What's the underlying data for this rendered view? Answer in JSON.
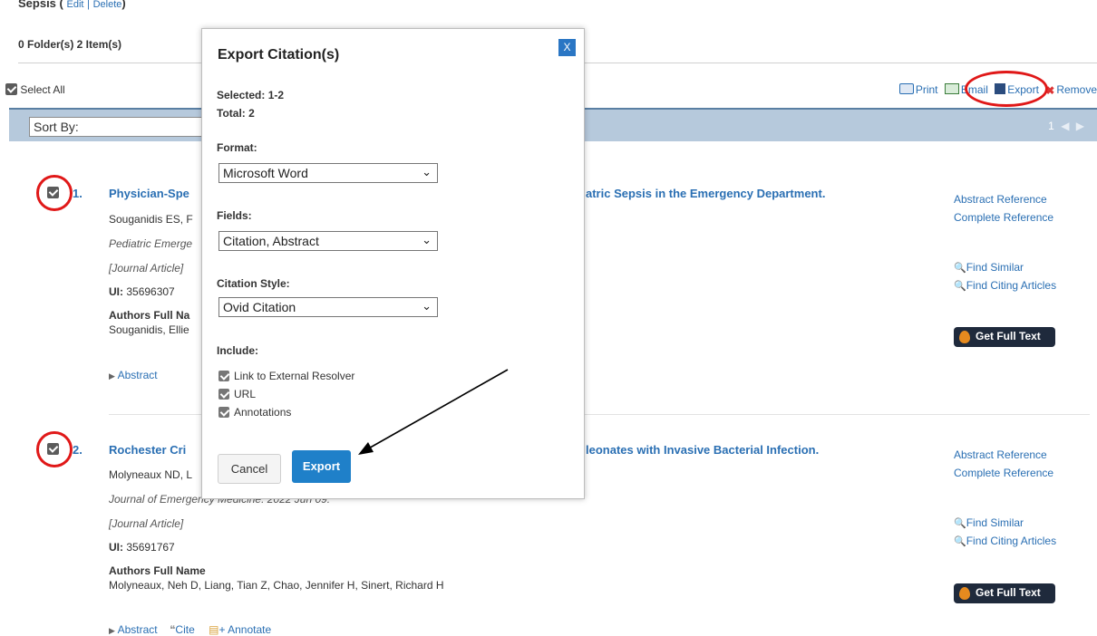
{
  "folder": {
    "name": "Sepsis",
    "paren_open": "(",
    "edit": "Edit",
    "sep": "|",
    "delete": "Delete",
    "paren_close": ")",
    "count": "0 Folder(s) 2 Item(s)"
  },
  "toolbar": {
    "select_all": "Select All",
    "print": "Print",
    "email": "Email",
    "export": "Export",
    "remove": "Remove"
  },
  "sortbar": {
    "sort_label": "Sort By:",
    "page": "1"
  },
  "results": [
    {
      "num": "1.",
      "title_start": "Physician-Spe",
      "title_end": "atric Sepsis in the Emergency Department.",
      "authors": "Souganidis ES, F",
      "journal": "Pediatric Emerge",
      "pubtype": "[Journal Article]",
      "ui_label": "UI:",
      "ui": "35696307",
      "authors_full_label": "Authors Full Na",
      "authors_full": "Souganidis, Ellie",
      "abstract": "Abstract",
      "cite": "",
      "annotate": ""
    },
    {
      "num": "2.",
      "title_start": "Rochester Cri",
      "title_end": "leonates with Invasive Bacterial Infection.",
      "authors": "Molyneaux ND, L",
      "journal": "Journal of Emergency Medicine. 2022 Jun 09.",
      "pubtype": "[Journal Article]",
      "ui_label": "UI:",
      "ui": "35691767",
      "authors_full_label": "Authors Full Name",
      "authors_full": "Molyneaux, Neh D, Liang, Tian Z, Chao, Jennifer H, Sinert, Richard H",
      "abstract": "Abstract",
      "cite": "Cite",
      "annotate": "+ Annotate"
    }
  ],
  "side_links": {
    "abstract_ref": "Abstract Reference",
    "complete_ref": "Complete Reference",
    "find_similar": "Find Similar",
    "find_citing": "Find Citing Articles",
    "get_full_text": "Get Full Text"
  },
  "modal": {
    "title": "Export Citation(s)",
    "close": "X",
    "selected": "Selected: 1-2",
    "total": "Total: 2",
    "format_label": "Format:",
    "format_value": "Microsoft Word",
    "fields_label": "Fields:",
    "fields_value": "Citation, Abstract",
    "style_label": "Citation Style:",
    "style_value": "Ovid Citation",
    "include_label": "Include:",
    "include_options": [
      "Link to External Resolver",
      "URL",
      "Annotations"
    ],
    "cancel": "Cancel",
    "export": "Export"
  },
  "colors": {
    "link": "#2a6fb3",
    "sortbar": "#b6c9dc",
    "export_button": "#1f80c9",
    "annotation_red": "#e01818"
  }
}
